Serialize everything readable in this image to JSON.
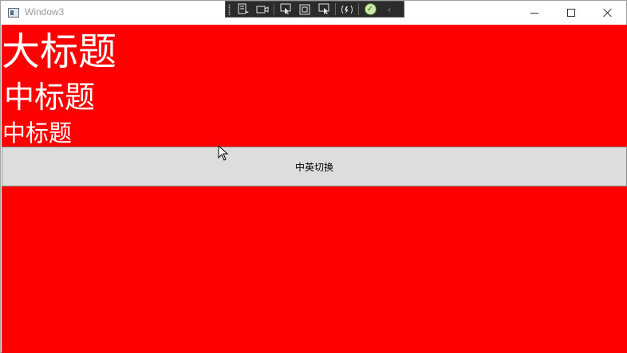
{
  "window": {
    "title": "Window3"
  },
  "devbar": {
    "tools": [
      "live-visual-tree-icon",
      "record-icon",
      "select-element-icon",
      "display-layout-adorners-icon",
      "track-focus-icon",
      "hot-reload-icon",
      "check-icon",
      "collapse-chevron-icon"
    ]
  },
  "content": {
    "large_heading": "大标题",
    "medium_heading_1": "中标题",
    "medium_heading_2": "中标题",
    "toggle_button_label": "中英切换"
  },
  "colors": {
    "background": "#ff0000",
    "heading_text": "#ffffff",
    "button_bg": "#dddddd"
  }
}
